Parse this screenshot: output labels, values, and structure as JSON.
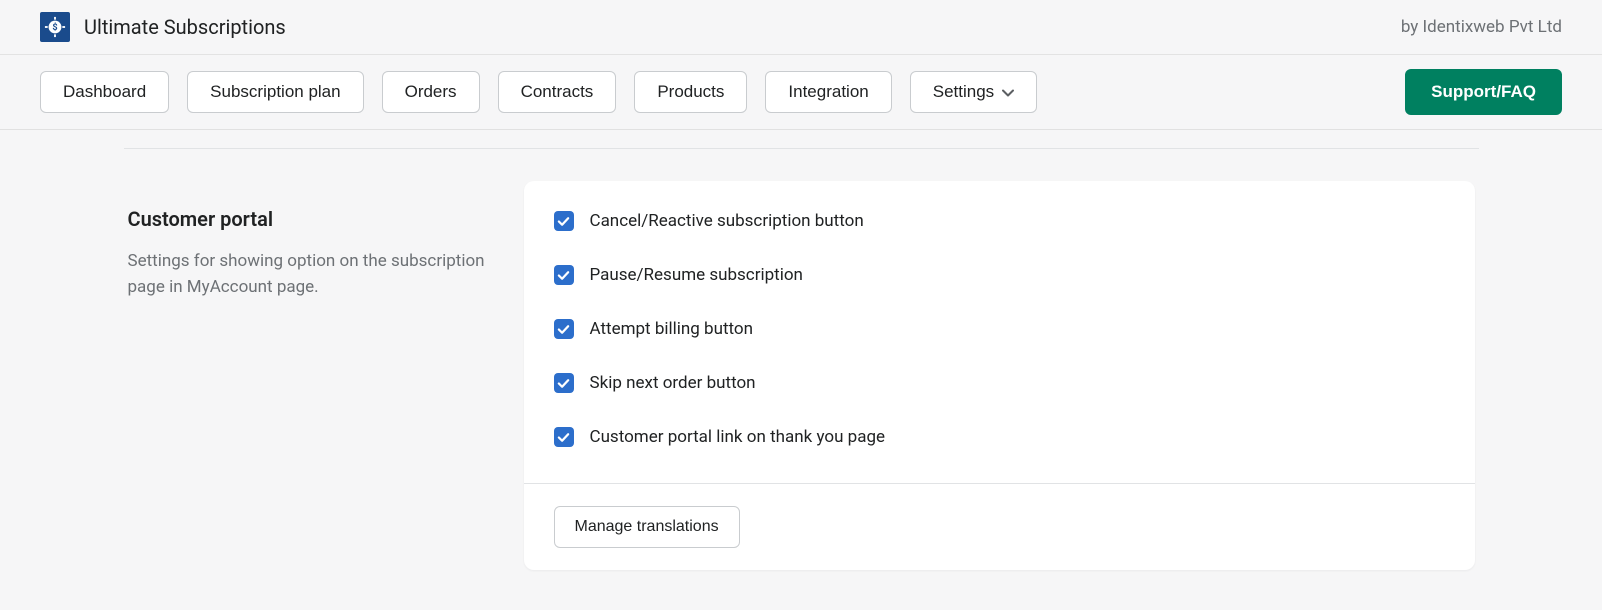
{
  "header": {
    "app_title": "Ultimate Subscriptions",
    "vendor_text": "by Identixweb Pvt Ltd"
  },
  "nav": {
    "items": [
      {
        "label": "Dashboard"
      },
      {
        "label": "Subscription plan"
      },
      {
        "label": "Orders"
      },
      {
        "label": "Contracts"
      },
      {
        "label": "Products"
      },
      {
        "label": "Integration"
      },
      {
        "label": "Settings",
        "has_dropdown": true
      }
    ],
    "support_label": "Support/FAQ"
  },
  "section": {
    "title": "Customer portal",
    "description": "Settings for showing option on the subscription page in MyAccount page."
  },
  "options": [
    {
      "label": "Cancel/Reactive subscription button",
      "checked": true
    },
    {
      "label": "Pause/Resume subscription",
      "checked": true
    },
    {
      "label": "Attempt billing button",
      "checked": true
    },
    {
      "label": "Skip next order button",
      "checked": true
    },
    {
      "label": "Customer portal link on thank you page",
      "checked": true
    }
  ],
  "footer": {
    "manage_translations_label": "Manage translations"
  },
  "colors": {
    "primary_button": "#008060",
    "checkbox": "#2c6ecb"
  }
}
